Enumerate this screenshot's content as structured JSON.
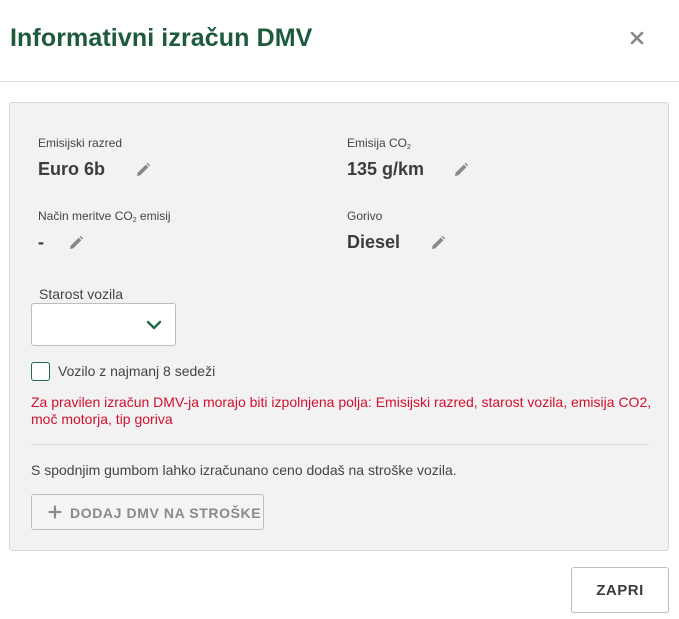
{
  "header": {
    "title": "Informativni izračun DMV",
    "close_icon": "close-icon"
  },
  "fields": {
    "emission_class": {
      "label": "Emisijski razred",
      "value": "Euro 6b"
    },
    "co2_emission": {
      "label_main": "Emisija CO",
      "label_sub": "2",
      "value": "135 g/km"
    },
    "co2_method": {
      "label_main": "Način meritve CO",
      "label_sub": "2",
      "label_rest": " emisij",
      "value": "-"
    },
    "fuel": {
      "label": "Gorivo",
      "value": "Diesel"
    }
  },
  "vehicle_age": {
    "label": "Starost vozila",
    "selected": ""
  },
  "seats_checkbox": {
    "label": "Vozilo z najmanj 8 sedeži",
    "checked": false
  },
  "error": {
    "text": "Za pravilen izračun DMV-ja morajo biti izpolnjena polja: Emisijski razred, starost vozila, emisija CO2, moč motorja, tip goriva"
  },
  "info": {
    "text": "S spodnjim gumbom lahko izračunano ceno dodaš na stroške vozila."
  },
  "add_button": {
    "label": "DODAJ DMV NA STROŠKE"
  },
  "footer": {
    "close_label": "ZAPRI"
  },
  "colors": {
    "title": "#1e5a3c",
    "accent": "#1e6b45",
    "error": "#d2102f",
    "panel_bg": "#f2f2f2"
  }
}
